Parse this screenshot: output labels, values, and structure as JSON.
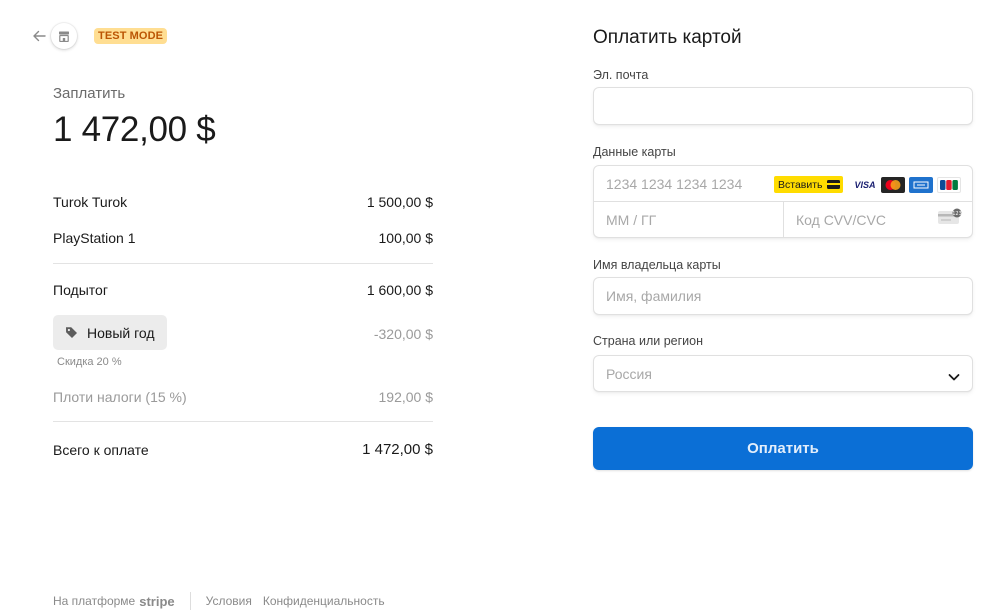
{
  "badge": {
    "test_mode": "TEST MODE"
  },
  "summary": {
    "pay_label": "Заплатить",
    "amount": "1 472,00 $",
    "items": [
      {
        "name": "Turok Turok",
        "price": "1 500,00 $"
      },
      {
        "name": "PlayStation 1",
        "price": "100,00 $"
      }
    ],
    "subtotal_label": "Подытог",
    "subtotal_value": "1 600,00 $",
    "promo_label": "Новый год",
    "promo_value": "-320,00 $",
    "discount_note": "Скидка 20 %",
    "tax_label": "Плоти налоги (15 %)",
    "tax_value": "192,00 $",
    "total_label": "Всего к оплате",
    "total_value": "1 472,00 $"
  },
  "footer": {
    "powered_by": "На платформе",
    "brand": "stripe",
    "terms": "Условия",
    "privacy": "Конфиденциальность"
  },
  "form": {
    "title": "Оплатить картой",
    "email_label": "Эл. почта",
    "email_value": "",
    "card_label": "Данные карты",
    "card_number_placeholder": "1234 1234 1234 1234",
    "paste_button": "Вставить",
    "card_brands": [
      "VISA",
      "Mastercard",
      "American Express",
      "JCB"
    ],
    "expiry_placeholder": "ММ / ГГ",
    "cvc_placeholder": "Код CVV/CVC",
    "name_label": "Имя владельца карты",
    "name_placeholder": "Имя, фамилия",
    "country_label": "Страна или регион",
    "country_value": "Россия",
    "pay_button": "Оплатить"
  },
  "icons": {
    "back": "arrow-left-icon",
    "shop": "storefront-icon",
    "promo": "tag-icon",
    "select": "chevron-down-icon",
    "cvc": "cvc-card-icon"
  },
  "colors": {
    "test_mode_bg": "#ffde92",
    "test_mode_text": "#bb5504",
    "pay_button": "#0b6fd6",
    "paste_button": "#ffdc00"
  }
}
